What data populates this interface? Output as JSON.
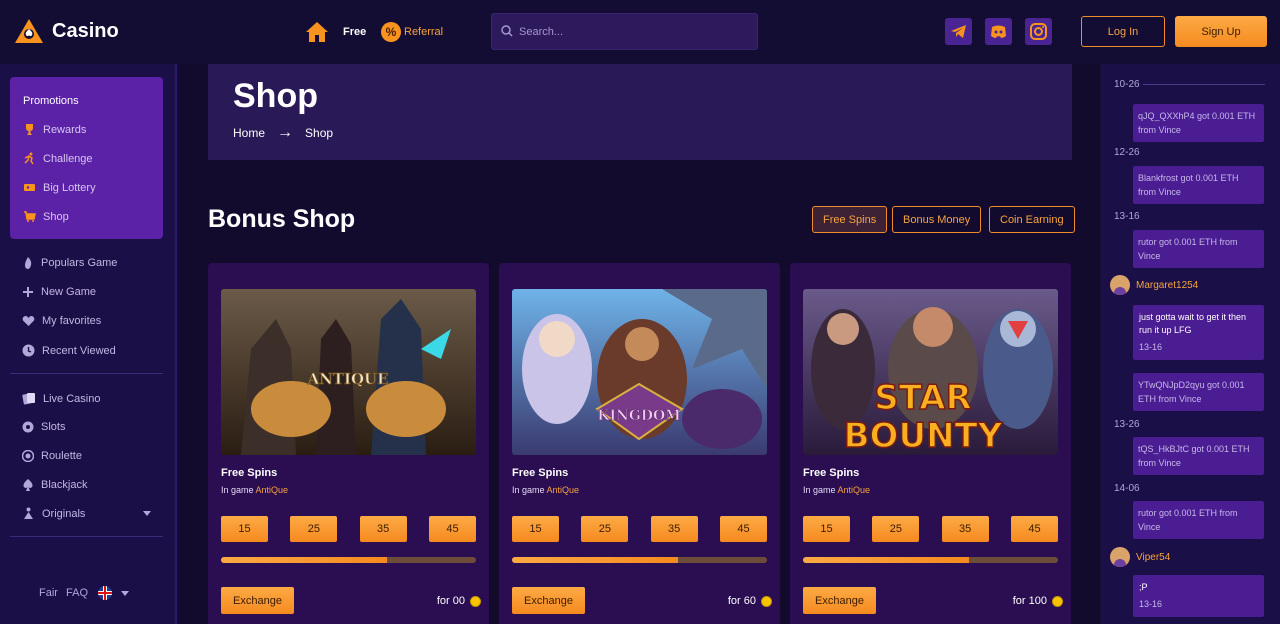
{
  "header": {
    "logo_text": "Casino",
    "nav_free": "Free",
    "nav_referral": "Referral",
    "search_placeholder": "Search...",
    "login_label": "Log In",
    "signup_label": "Sign Up"
  },
  "sidebar": {
    "promotions_title": "Promotions",
    "promo_items": [
      {
        "label": "Rewards",
        "icon": "trophy-icon"
      },
      {
        "label": "Challenge",
        "icon": "runner-icon"
      },
      {
        "label": "Big Lottery",
        "icon": "ticket-icon"
      },
      {
        "label": "Shop",
        "icon": "cart-icon"
      }
    ],
    "items": [
      {
        "label": "Populars Game",
        "icon": "flame-icon"
      },
      {
        "label": "New Game",
        "icon": "plus-icon"
      },
      {
        "label": "My favorites",
        "icon": "heart-icon"
      },
      {
        "label": "Recent Viewed",
        "icon": "clock-icon"
      }
    ],
    "games": [
      {
        "label": "Live Casino",
        "icon": "cards-icon"
      },
      {
        "label": "Slots",
        "icon": "slots-icon"
      },
      {
        "label": "Roulette",
        "icon": "roulette-icon"
      },
      {
        "label": "Blackjack",
        "icon": "spade-icon"
      },
      {
        "label": "Originals",
        "icon": "originals-icon"
      }
    ],
    "footer": {
      "fair": "Fair",
      "faq": "FAQ"
    }
  },
  "main": {
    "hero_title": "Shop",
    "breadcrumb": {
      "home": "Home",
      "arrow": "→",
      "current": "Shop"
    },
    "section_title": "Bonus Shop",
    "filters": [
      "Free Spins",
      "Bonus Money",
      "Coin Earning"
    ],
    "cards": [
      {
        "title": "Free Spins",
        "in_game_label": "In game",
        "game": "AntiQue",
        "art_text": "ANTIQUE",
        "chips": [
          "15",
          "25",
          "35",
          "45"
        ],
        "progress": 0.65,
        "exchange_label": "Exchange",
        "price": "for 00"
      },
      {
        "title": "Free Spins",
        "in_game_label": "In game",
        "game": "AntiQue",
        "art_text": "KINGDOM",
        "chips": [
          "15",
          "25",
          "35",
          "45"
        ],
        "progress": 0.65,
        "exchange_label": "Exchange",
        "price": "for 60"
      },
      {
        "title": "Free Spins",
        "in_game_label": "In game",
        "game": "AntiQue",
        "art_text": [
          "STAR",
          "BOUNTY"
        ],
        "chips": [
          "15",
          "25",
          "35",
          "45"
        ],
        "progress": 0.65,
        "exchange_label": "Exchange",
        "price": "for 100"
      }
    ]
  },
  "feed": {
    "entries": [
      {
        "type": "date",
        "text": "10-26"
      },
      {
        "type": "msg",
        "text": "qJQ_QXXhP4 got 0.001 ETH from Vince"
      },
      {
        "type": "date",
        "text": "12-26"
      },
      {
        "type": "msg",
        "text": "Blankfrost got 0.001 ETH from Vince"
      },
      {
        "type": "date",
        "text": "13-16"
      },
      {
        "type": "msg",
        "text": "rutor got 0.001 ETH from Vince"
      },
      {
        "type": "user",
        "text": "Margaret1254"
      },
      {
        "type": "chat",
        "text": "just gotta wait to get it then run it up LFG",
        "time": "13-16"
      },
      {
        "type": "msg",
        "text": "YTwQNJpD2qyu got 0.001 ETH from Vince"
      },
      {
        "type": "date",
        "text": "13-26"
      },
      {
        "type": "msg",
        "text": "tQS_HkBJtC got 0.001 ETH from Vince"
      },
      {
        "type": "date",
        "text": "14-06"
      },
      {
        "type": "msg",
        "text": "rutor got 0.001 ETH from Vince"
      },
      {
        "type": "user",
        "text": "Viper54"
      },
      {
        "type": "chat",
        "text": ";P",
        "time": "13-16"
      }
    ]
  },
  "colors": {
    "accent": "#f7a33c",
    "panel": "#2b0d52",
    "promo": "#5b21a6"
  }
}
